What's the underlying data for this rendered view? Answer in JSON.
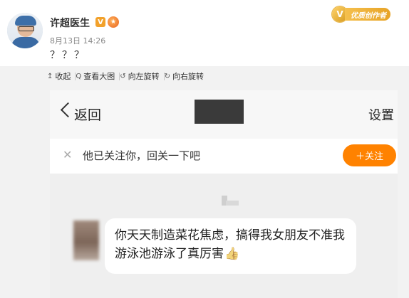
{
  "post": {
    "author": "许超医生",
    "verified_badge": "V",
    "time": "8月13日 14:26",
    "text": "？？？",
    "vip_badge_label": "优质创作者"
  },
  "toolbar": {
    "items": [
      {
        "icon": "collapse-icon",
        "glyph": "↥",
        "label": "收起"
      },
      {
        "icon": "magnifier-icon",
        "glyph": "Q",
        "label": "查看大图"
      },
      {
        "icon": "rotate-left-icon",
        "glyph": "↺",
        "label": "向左旋转"
      },
      {
        "icon": "rotate-right-icon",
        "glyph": "↻",
        "label": "向右旋转"
      }
    ]
  },
  "screenshot": {
    "back_label": "返回",
    "settings_label": "设置",
    "follow_prompt": "他已关注你，回关一下吧",
    "follow_button": "＋关注",
    "message_text": "你天天制造菜花焦虑，搞得我女朋友不准我游泳池游泳了真厉害",
    "message_emoji": "👍"
  },
  "colors": {
    "accent_orange": "#ff8200",
    "vip_gold": "#e7a326",
    "viewer_bg": "#f2f2f2"
  }
}
